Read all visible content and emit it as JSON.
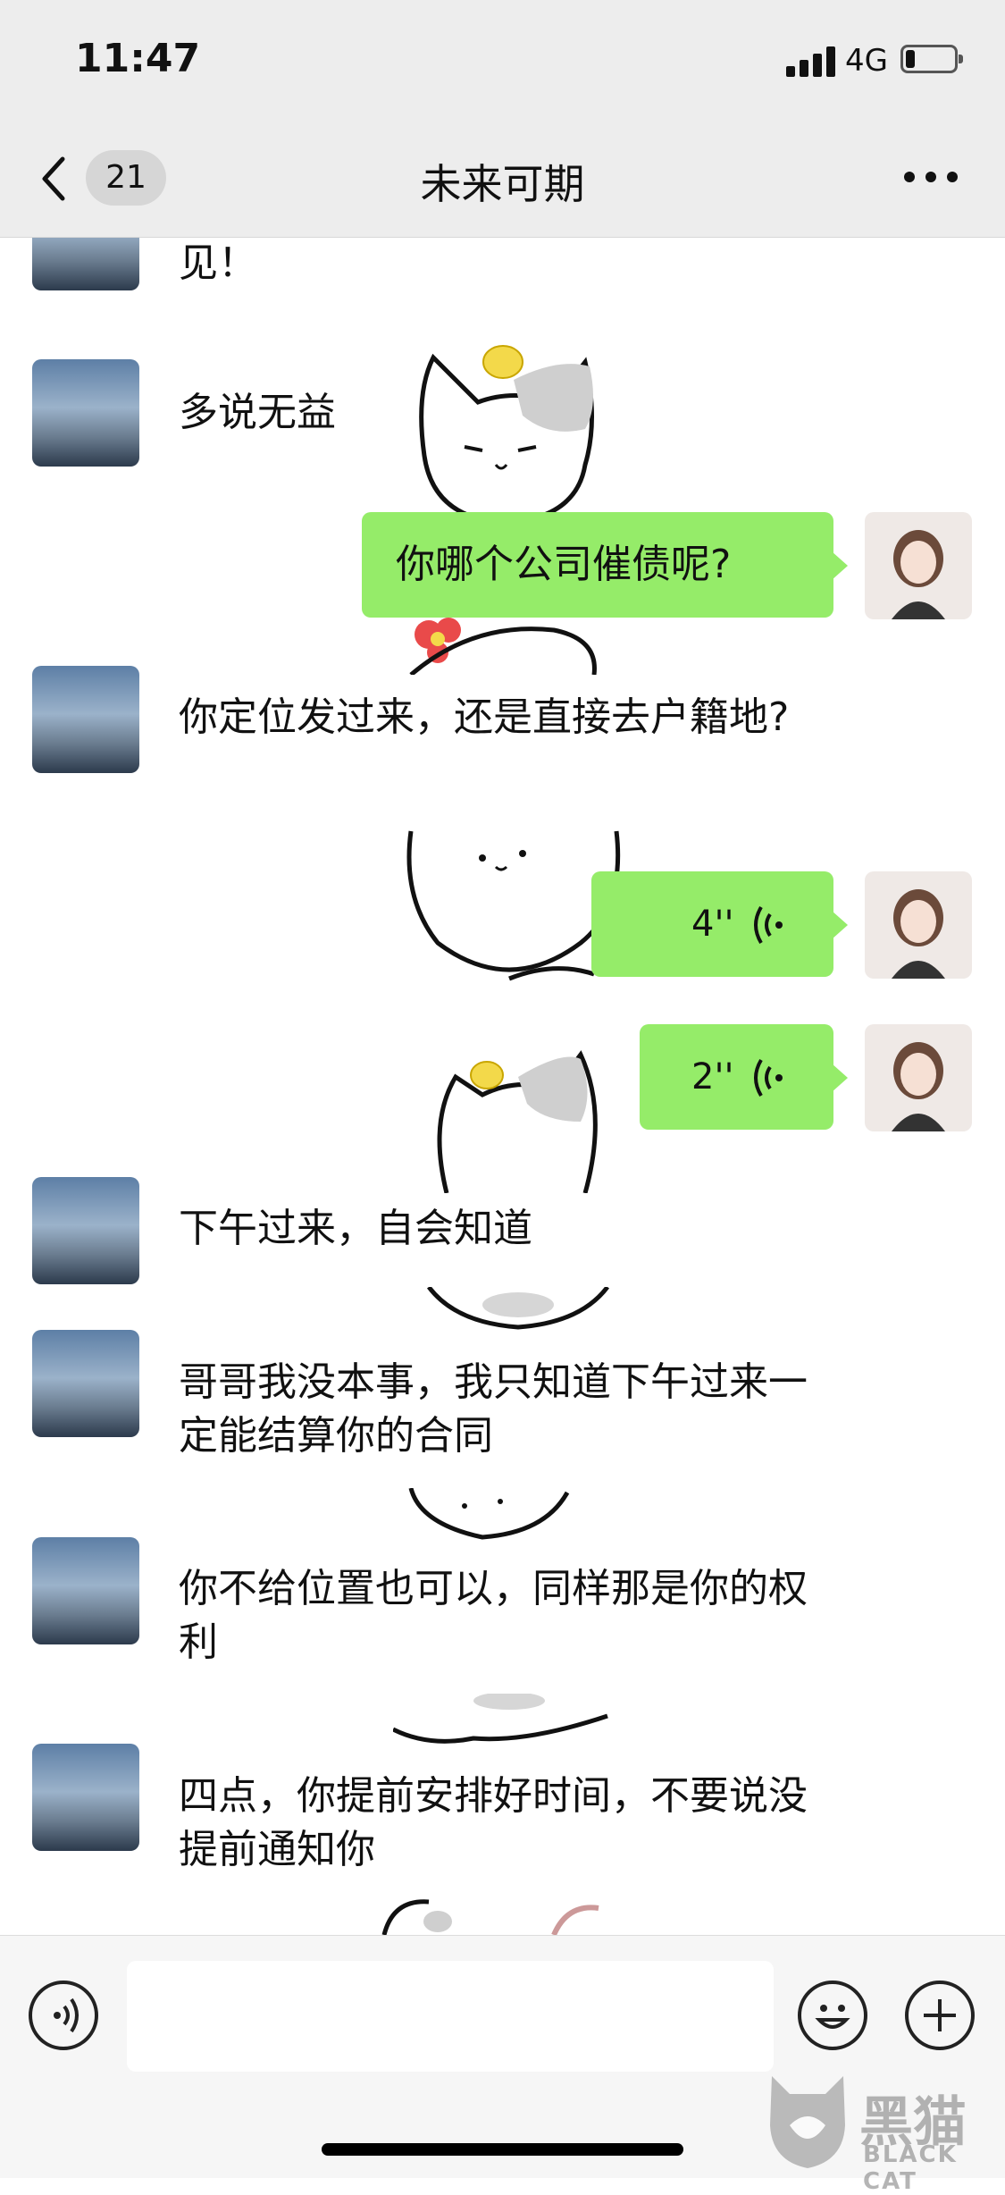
{
  "status_bar": {
    "time": "11:47",
    "network": "4G"
  },
  "nav": {
    "back_count": "21",
    "title": "未来可期"
  },
  "messages": {
    "m0": "见！",
    "m1": "多说无益",
    "m2": "你哪个公司催债呢?",
    "m3": "你定位发过来，还是直接去户籍地?",
    "m4_duration": "4''",
    "m5_duration": "2''",
    "m6": "下午过来，自会知道",
    "m7": "哥哥我没本事，我只知道下午过来一定能结算你的合同",
    "m8": "你不给位置也可以，同样那是你的权利",
    "m9": "四点，你提前安排好时间，不要说没提前通知你"
  },
  "watermark": {
    "brand": "黑猫",
    "sub": "BLACK CAT"
  },
  "colors": {
    "bubble_self": "#95ec69",
    "nav_bg": "#ededed",
    "chat_bg": "#ffffff"
  }
}
